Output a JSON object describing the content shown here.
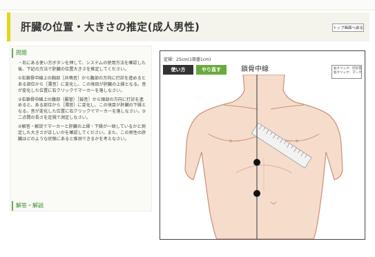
{
  "header": {
    "title": "肝臓の位置・大きさの推定(成人男性)",
    "top_button": "トップ画面へ戻る"
  },
  "left_panel": {
    "question_heading": "問題",
    "paragraphs": [
      "・右にある使い方ボタンを押して、システムの使用方法を確認した後、下記の方法で肝臓の位置大きさを推定してください。",
      "①右鎖骨中線上の胸部［共鳴音］から腹部の方向に打診を進めるとある部位から［濁音］に変化し、この境目が肝臓の上縁となる。音が変化した位置に右クリックでマーカーを落しなさい。",
      "②右鎖骨中線上の腹部（腸管）［鼓音］から頭部の方向に打診を進めると、ある部位から［濁音］に変化し、この境目が肝臓の下縁となる。音が変化した位置に右クリックでマーカーを落しなさい。③二点間の長さを定規で測定しなさい。",
      "④解答・解説でマーカーと肝臓の上縁・下縁が一致しているかと測定した大きさが正しいかを確認してください。また、この男性の肝臓はどのような状態にあると推測できるかを考えなさい。"
    ],
    "answer_heading": "解答・解説"
  },
  "simulator": {
    "scale_text": "定規：25cm(1目盛1cm)",
    "usage_button": "使い方",
    "redo_button": "やり直す",
    "midline_label": "鎖骨中線",
    "legend": [
      "右クリック：打診音",
      "右クリック：マーク"
    ]
  },
  "colors": {
    "accent_yellow": "#e3d51a",
    "green": "#6aaa3e",
    "skin": "#f6dccb",
    "skin_line": "#c98f78"
  }
}
